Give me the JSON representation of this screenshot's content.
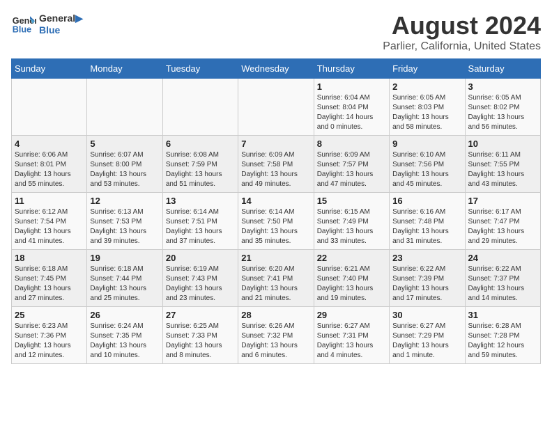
{
  "header": {
    "logo_line1": "General",
    "logo_line2": "Blue",
    "main_title": "August 2024",
    "subtitle": "Parlier, California, United States"
  },
  "days_of_week": [
    "Sunday",
    "Monday",
    "Tuesday",
    "Wednesday",
    "Thursday",
    "Friday",
    "Saturday"
  ],
  "weeks": [
    [
      {
        "day": "",
        "info": ""
      },
      {
        "day": "",
        "info": ""
      },
      {
        "day": "",
        "info": ""
      },
      {
        "day": "",
        "info": ""
      },
      {
        "day": "1",
        "info": "Sunrise: 6:04 AM\nSunset: 8:04 PM\nDaylight: 14 hours\nand 0 minutes."
      },
      {
        "day": "2",
        "info": "Sunrise: 6:05 AM\nSunset: 8:03 PM\nDaylight: 13 hours\nand 58 minutes."
      },
      {
        "day": "3",
        "info": "Sunrise: 6:05 AM\nSunset: 8:02 PM\nDaylight: 13 hours\nand 56 minutes."
      }
    ],
    [
      {
        "day": "4",
        "info": "Sunrise: 6:06 AM\nSunset: 8:01 PM\nDaylight: 13 hours\nand 55 minutes."
      },
      {
        "day": "5",
        "info": "Sunrise: 6:07 AM\nSunset: 8:00 PM\nDaylight: 13 hours\nand 53 minutes."
      },
      {
        "day": "6",
        "info": "Sunrise: 6:08 AM\nSunset: 7:59 PM\nDaylight: 13 hours\nand 51 minutes."
      },
      {
        "day": "7",
        "info": "Sunrise: 6:09 AM\nSunset: 7:58 PM\nDaylight: 13 hours\nand 49 minutes."
      },
      {
        "day": "8",
        "info": "Sunrise: 6:09 AM\nSunset: 7:57 PM\nDaylight: 13 hours\nand 47 minutes."
      },
      {
        "day": "9",
        "info": "Sunrise: 6:10 AM\nSunset: 7:56 PM\nDaylight: 13 hours\nand 45 minutes."
      },
      {
        "day": "10",
        "info": "Sunrise: 6:11 AM\nSunset: 7:55 PM\nDaylight: 13 hours\nand 43 minutes."
      }
    ],
    [
      {
        "day": "11",
        "info": "Sunrise: 6:12 AM\nSunset: 7:54 PM\nDaylight: 13 hours\nand 41 minutes."
      },
      {
        "day": "12",
        "info": "Sunrise: 6:13 AM\nSunset: 7:53 PM\nDaylight: 13 hours\nand 39 minutes."
      },
      {
        "day": "13",
        "info": "Sunrise: 6:14 AM\nSunset: 7:51 PM\nDaylight: 13 hours\nand 37 minutes."
      },
      {
        "day": "14",
        "info": "Sunrise: 6:14 AM\nSunset: 7:50 PM\nDaylight: 13 hours\nand 35 minutes."
      },
      {
        "day": "15",
        "info": "Sunrise: 6:15 AM\nSunset: 7:49 PM\nDaylight: 13 hours\nand 33 minutes."
      },
      {
        "day": "16",
        "info": "Sunrise: 6:16 AM\nSunset: 7:48 PM\nDaylight: 13 hours\nand 31 minutes."
      },
      {
        "day": "17",
        "info": "Sunrise: 6:17 AM\nSunset: 7:47 PM\nDaylight: 13 hours\nand 29 minutes."
      }
    ],
    [
      {
        "day": "18",
        "info": "Sunrise: 6:18 AM\nSunset: 7:45 PM\nDaylight: 13 hours\nand 27 minutes."
      },
      {
        "day": "19",
        "info": "Sunrise: 6:18 AM\nSunset: 7:44 PM\nDaylight: 13 hours\nand 25 minutes."
      },
      {
        "day": "20",
        "info": "Sunrise: 6:19 AM\nSunset: 7:43 PM\nDaylight: 13 hours\nand 23 minutes."
      },
      {
        "day": "21",
        "info": "Sunrise: 6:20 AM\nSunset: 7:41 PM\nDaylight: 13 hours\nand 21 minutes."
      },
      {
        "day": "22",
        "info": "Sunrise: 6:21 AM\nSunset: 7:40 PM\nDaylight: 13 hours\nand 19 minutes."
      },
      {
        "day": "23",
        "info": "Sunrise: 6:22 AM\nSunset: 7:39 PM\nDaylight: 13 hours\nand 17 minutes."
      },
      {
        "day": "24",
        "info": "Sunrise: 6:22 AM\nSunset: 7:37 PM\nDaylight: 13 hours\nand 14 minutes."
      }
    ],
    [
      {
        "day": "25",
        "info": "Sunrise: 6:23 AM\nSunset: 7:36 PM\nDaylight: 13 hours\nand 12 minutes."
      },
      {
        "day": "26",
        "info": "Sunrise: 6:24 AM\nSunset: 7:35 PM\nDaylight: 13 hours\nand 10 minutes."
      },
      {
        "day": "27",
        "info": "Sunrise: 6:25 AM\nSunset: 7:33 PM\nDaylight: 13 hours\nand 8 minutes."
      },
      {
        "day": "28",
        "info": "Sunrise: 6:26 AM\nSunset: 7:32 PM\nDaylight: 13 hours\nand 6 minutes."
      },
      {
        "day": "29",
        "info": "Sunrise: 6:27 AM\nSunset: 7:31 PM\nDaylight: 13 hours\nand 4 minutes."
      },
      {
        "day": "30",
        "info": "Sunrise: 6:27 AM\nSunset: 7:29 PM\nDaylight: 13 hours\nand 1 minute."
      },
      {
        "day": "31",
        "info": "Sunrise: 6:28 AM\nSunset: 7:28 PM\nDaylight: 12 hours\nand 59 minutes."
      }
    ]
  ]
}
